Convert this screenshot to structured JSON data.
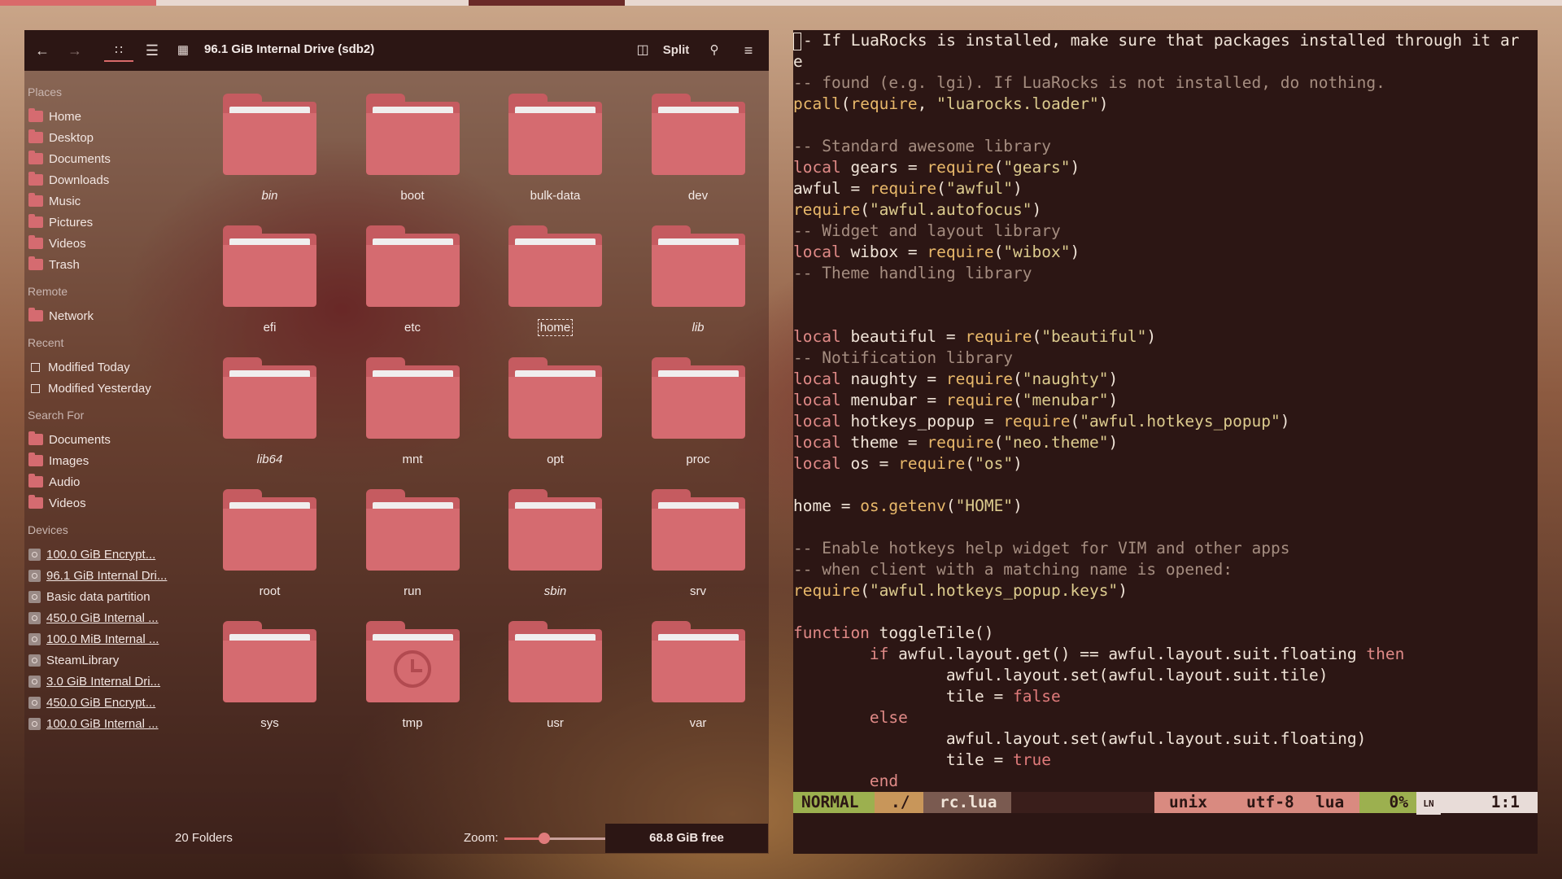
{
  "filemanager": {
    "title": "96.1 GiB Internal Drive (sdb2)",
    "split_label": "Split",
    "sections": {
      "places": "Places",
      "remote": "Remote",
      "recent": "Recent",
      "search_for": "Search For",
      "devices": "Devices"
    },
    "places": [
      "Home",
      "Desktop",
      "Documents",
      "Downloads",
      "Music",
      "Pictures",
      "Videos",
      "Trash"
    ],
    "remote": [
      "Network"
    ],
    "recent": [
      "Modified Today",
      "Modified Yesterday"
    ],
    "search_for": [
      "Documents",
      "Images",
      "Audio",
      "Videos"
    ],
    "devices": [
      "100.0 GiB Encrypt...",
      "96.1 GiB Internal Dri...",
      "Basic data partition",
      "450.0 GiB Internal ...",
      "100.0 MiB Internal ...",
      "SteamLibrary",
      "3.0 GiB Internal Dri...",
      "450.0 GiB Encrypt...",
      "100.0 GiB Internal ..."
    ],
    "folders": [
      "bin",
      "boot",
      "bulk-data",
      "dev",
      "efi",
      "etc",
      "home",
      "lib",
      "lib64",
      "mnt",
      "opt",
      "proc",
      "root",
      "run",
      "sbin",
      "srv",
      "sys",
      "tmp",
      "usr",
      "var"
    ],
    "italic_folders": [
      "bin",
      "lib",
      "lib64",
      "sbin"
    ],
    "selected_folder": "home",
    "folder_count": "20 Folders",
    "zoom_label": "Zoom:",
    "zoom_level": 0.38,
    "free_space": "68.8 GiB free",
    "accent": "#d96a6a",
    "folder_color": "#d56b70"
  },
  "editor": {
    "lines": [
      "-- If LuaRocks is installed, make sure that packages installed through it ar",
      "e",
      "-- found (e.g. lgi). If LuaRocks is not installed, do nothing.",
      "pcall(require, \"luarocks.loader\")",
      "",
      "-- Standard awesome library",
      "local gears = require(\"gears\")",
      "awful = require(\"awful\")",
      "require(\"awful.autofocus\")",
      "-- Widget and layout library",
      "local wibox = require(\"wibox\")",
      "-- Theme handling library",
      "",
      "",
      "local beautiful = require(\"beautiful\")",
      "-- Notification library",
      "local naughty = require(\"naughty\")",
      "local menubar = require(\"menubar\")",
      "local hotkeys_popup = require(\"awful.hotkeys_popup\")",
      "local theme = require(\"neo.theme\")",
      "local os = require(\"os\")",
      "",
      "home = os.getenv(\"HOME\")",
      "",
      "-- Enable hotkeys help widget for VIM and other apps",
      "-- when client with a matching name is opened:",
      "require(\"awful.hotkeys_popup.keys\")",
      "",
      "function toggleTile()",
      "        if awful.layout.get() == awful.layout.suit.floating then",
      "                awful.layout.set(awful.layout.suit.tile)",
      "                tile = false",
      "        else",
      "                awful.layout.set(awful.layout.suit.floating)",
      "                tile = true",
      "        end"
    ],
    "status": {
      "mode": "NORMAL",
      "path": "./",
      "file": "rc.lua",
      "format": "unix",
      "encoding": "utf-8",
      "filetype": "lua",
      "percent": "0%",
      "ln_label": "LN",
      "position": "1:1"
    }
  }
}
